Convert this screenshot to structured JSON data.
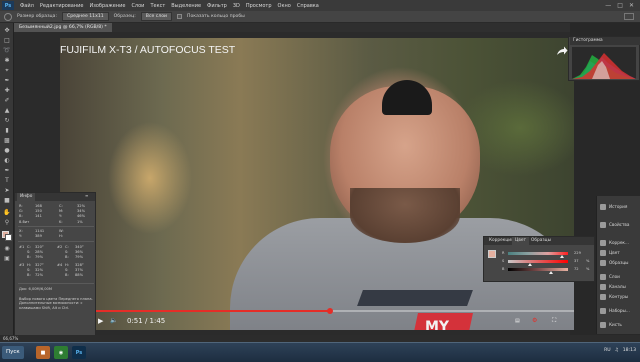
{
  "menubar": {
    "items": [
      "Файл",
      "Редактирование",
      "Изображение",
      "Слои",
      "Текст",
      "Выделение",
      "Фильтр",
      "3D",
      "Просмотр",
      "Окно",
      "Справка"
    ]
  },
  "options": {
    "size_label": "Размер образца:",
    "size_value": "Среднее 11x11",
    "sample_label": "Образец:",
    "sample_value": "Все слои",
    "ring_label": "Показать кольцо пробы"
  },
  "document": {
    "tab_title": "Безымянный2.jpg @ 66,7% (RGB/8) *"
  },
  "video": {
    "title": "FUJIFILM X-T3 / AUTOFOCUS TEST",
    "time": "0:51 / 1:45",
    "logo_text": "MY",
    "progress_fraction": 0.49,
    "accent": "#e52d27"
  },
  "info_panel": {
    "tab": "Инфо",
    "rows": [
      [
        "R:",
        "168",
        "C:",
        "32%"
      ],
      [
        "G:",
        "150",
        "M:",
        "34%"
      ],
      [
        "B:",
        "141",
        "Y:",
        "46%"
      ],
      [
        "8-бит",
        "",
        "K:",
        "1%"
      ]
    ],
    "xy": [
      "X:",
      "1141",
      "W:",
      ""
    ],
    "xy2": [
      "Y:",
      "389",
      "H:",
      ""
    ],
    "samples": [
      [
        "#1",
        "C:",
        "320°",
        "#2",
        "C:",
        "340°"
      ],
      [
        "",
        "S:",
        "28%",
        "",
        "S:",
        "36%"
      ],
      [
        "",
        "B:",
        "79%",
        "",
        "B:",
        "79%"
      ],
      [
        "#3",
        "H:",
        "327°",
        "#4",
        "H:",
        "328°"
      ],
      [
        "",
        "S:",
        "32%",
        "",
        "S:",
        "37%"
      ],
      [
        "",
        "B:",
        "72%",
        "",
        "B:",
        "88%"
      ]
    ],
    "doc": "Док: 6,00M/6,00M",
    "hint": "Выбор нового цвета Переднего плана. Дополнительные возможности: с клавишами Shift, Alt и Ctrl."
  },
  "color_panel": {
    "tabs": [
      "Коррекция",
      "Цвет",
      "Образцы"
    ],
    "rows": [
      {
        "label": "R",
        "value": "229",
        "unit": "",
        "pos": 0.9
      },
      {
        "label": "S",
        "value": "37",
        "unit": "%",
        "pos": 0.37
      },
      {
        "label": "B",
        "value": "72",
        "unit": "%",
        "pos": 0.72
      }
    ]
  },
  "histogram": {
    "title": "Гистограмма"
  },
  "right_panels": {
    "top": [
      "История",
      "Свойства"
    ],
    "items": [
      "Коррек...",
      "Цвет",
      "Образцы",
      "Слои",
      "Каналы",
      "Контуры",
      "Наборы...",
      "Кисть"
    ]
  },
  "statusbar": {
    "zoom": "66,67%"
  },
  "taskbar": {
    "start": "Пуск",
    "apps": [
      "Ps"
    ],
    "lang": "RU",
    "clock": "18:13"
  }
}
